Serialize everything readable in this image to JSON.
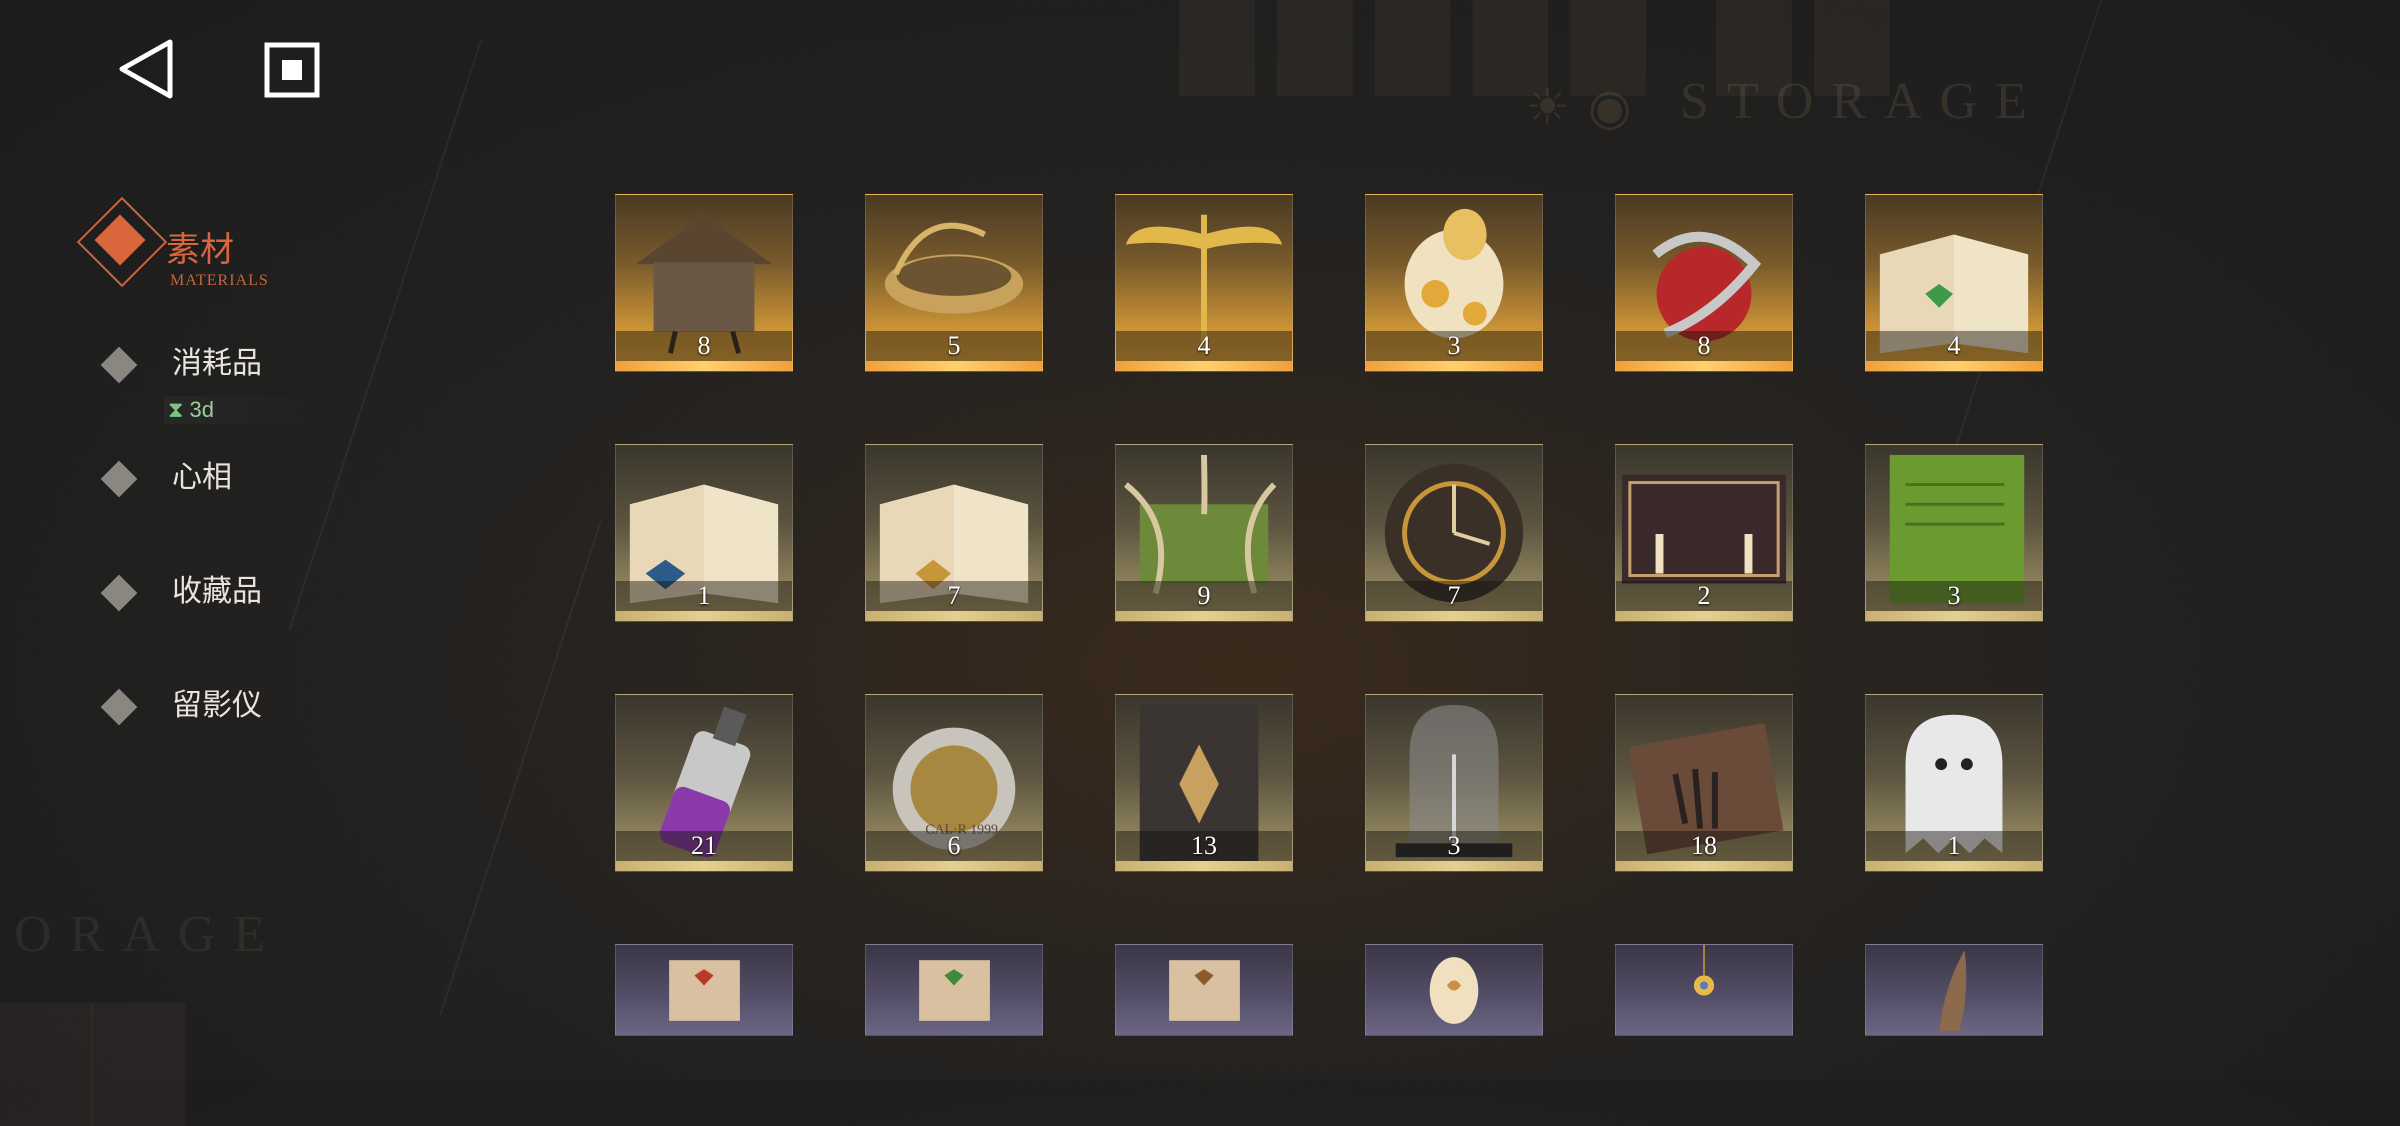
{
  "watermark": {
    "storage": "STORAGE",
    "storage_left": "ORAGE"
  },
  "nav": {
    "back_icon": "back-triangle-icon",
    "home_icon": "square-home-icon"
  },
  "sidebar": {
    "active": {
      "label": "素材",
      "sub": "MATERIALS",
      "color": "#d9653a"
    },
    "items": [
      {
        "label": "消耗品",
        "timer": "3d"
      },
      {
        "label": "心相"
      },
      {
        "label": "收藏品"
      },
      {
        "label": "留影仪"
      }
    ]
  },
  "inventory": {
    "rows": [
      {
        "rarity": "gold",
        "items": [
          {
            "icon": "chicken-leg-hut-icon",
            "count": "8"
          },
          {
            "icon": "golden-bowl-icon",
            "count": "5"
          },
          {
            "icon": "caduceus-icon",
            "count": "4"
          },
          {
            "icon": "golden-sheep-icon",
            "count": "3"
          },
          {
            "icon": "snake-apple-icon",
            "count": "8"
          },
          {
            "icon": "green-gem-book-icon",
            "count": "4"
          }
        ]
      },
      {
        "rarity": "beige",
        "items": [
          {
            "icon": "blue-gem-book-icon",
            "count": "1"
          },
          {
            "icon": "gold-gem-book-icon",
            "count": "7"
          },
          {
            "icon": "root-chest-icon",
            "count": "9"
          },
          {
            "icon": "astrolabe-clock-icon",
            "count": "7"
          },
          {
            "icon": "ouija-board-icon",
            "count": "2"
          },
          {
            "icon": "green-tablet-icon",
            "count": "3"
          }
        ]
      },
      {
        "rarity": "beige",
        "items": [
          {
            "icon": "potion-bottle-icon",
            "count": "21"
          },
          {
            "icon": "pocket-watch-icon",
            "count": "6"
          },
          {
            "icon": "dark-tome-icon",
            "count": "13"
          },
          {
            "icon": "glass-bell-jar-icon",
            "count": "3"
          },
          {
            "icon": "hand-in-box-icon",
            "count": "18"
          },
          {
            "icon": "ghost-icon",
            "count": "1"
          }
        ]
      },
      {
        "rarity": "purple",
        "items": [
          {
            "icon": "red-gem-scroll-icon",
            "count": ""
          },
          {
            "icon": "green-gem-scroll-icon",
            "count": ""
          },
          {
            "icon": "brown-gem-scroll-icon",
            "count": ""
          },
          {
            "icon": "ornate-egg-icon",
            "count": ""
          },
          {
            "icon": "sun-pendant-icon",
            "count": ""
          },
          {
            "icon": "bronze-ornament-icon",
            "count": ""
          }
        ]
      }
    ]
  }
}
